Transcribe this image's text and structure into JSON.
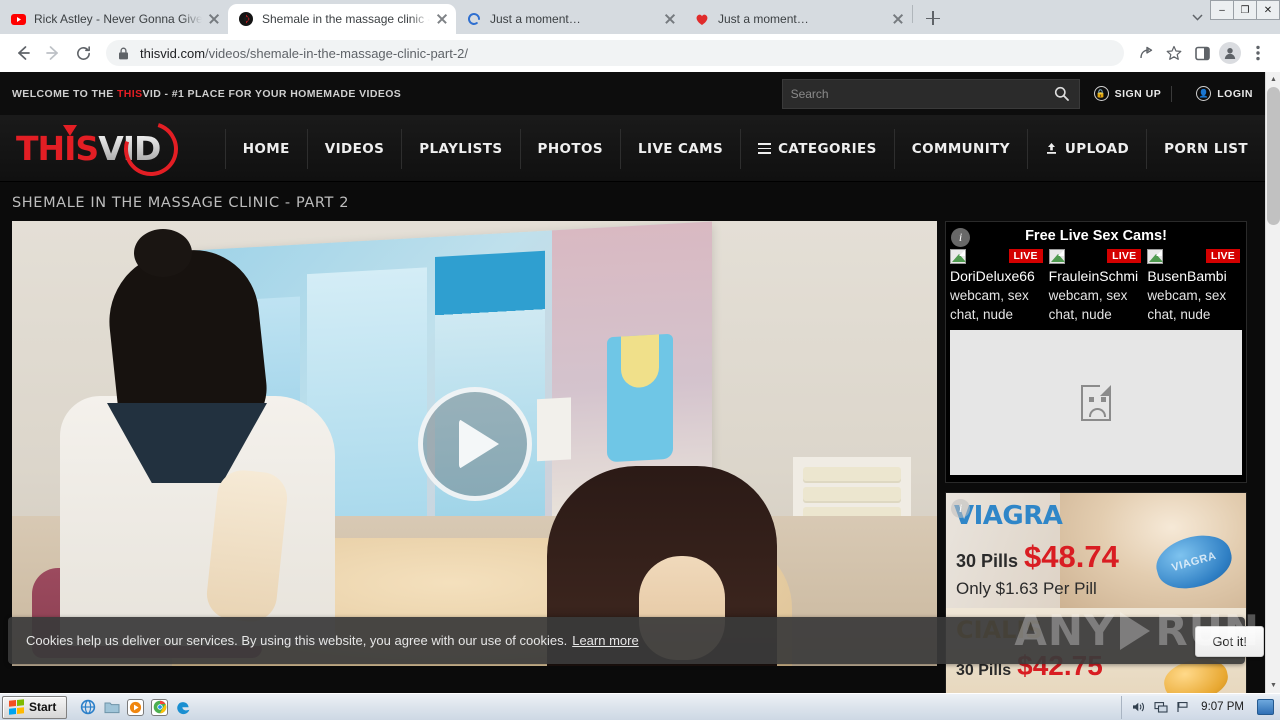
{
  "browser": {
    "tabs": [
      {
        "title": "Rick Astley - Never Gonna Give You",
        "favicon": "youtube-icon",
        "active": false
      },
      {
        "title": "Shemale in the massage clinic - part",
        "favicon": "thisvid-icon",
        "active": true
      },
      {
        "title": "Just a moment…",
        "favicon": "loading-spinner-icon",
        "active": false
      },
      {
        "title": "Just a moment…",
        "favicon": "heart-icon",
        "active": false
      }
    ],
    "new_tab_label": "+",
    "url_host": "thisvid.com",
    "url_path": "/videos/shemale-in-the-massage-clinic-part-2/",
    "window_controls": {
      "minimize": "–",
      "maximize": "❐",
      "close": "✕"
    }
  },
  "site": {
    "welcome_prefix": "WELCOME TO THE ",
    "welcome_brand": "THIS",
    "welcome_suffix": "VID - #1 PLACE FOR YOUR HOMEMADE VIDEOS",
    "search": {
      "placeholder": "Search",
      "value": ""
    },
    "sign_up": "SIGN UP",
    "login": "LOGIN",
    "logo": {
      "part1": "THIS",
      "part2": "VID"
    },
    "nav": [
      {
        "label": "HOME"
      },
      {
        "label": "VIDEOS"
      },
      {
        "label": "PLAYLISTS"
      },
      {
        "label": "PHOTOS"
      },
      {
        "label": "LIVE CAMS"
      },
      {
        "label": "CATEGORIES"
      },
      {
        "label": "COMMUNITY"
      },
      {
        "label": "UPLOAD"
      },
      {
        "label": "PORN LIST"
      }
    ],
    "video_title": "SHEMALE IN THE MASSAGE CLINIC - PART 2"
  },
  "cookie_banner": {
    "text": "Cookies help us deliver our services. By using this website, you agree with our use of cookies.",
    "link": "Learn more",
    "button": "Got it!"
  },
  "ads": {
    "cams": {
      "title": "Free Live Sex Cams!",
      "live_badge": "LIVE",
      "items": [
        {
          "name": "DoriDeluxe66",
          "desc_line1": "webcam, sex",
          "desc_line2": "chat, nude"
        },
        {
          "name": "FrauleinSchmi",
          "desc_line1": "webcam, sex",
          "desc_line2": "chat, nude"
        },
        {
          "name": "BusenBambi",
          "desc_line1": "webcam, sex",
          "desc_line2": "chat, nude"
        }
      ]
    },
    "pharma": {
      "viagra_brand": "VIAGRA",
      "viagra_qty": "30 Pills",
      "viagra_price": "$48.74",
      "viagra_sub": "Only $1.63 Per Pill",
      "viagra_pill_label": "VIAGRA",
      "cialis_brand": "CIALIS",
      "cialis_qty": "30 Pills",
      "cialis_price": "$42.75"
    }
  },
  "watermark": {
    "left": "ANY",
    "right": "RUN"
  },
  "taskbar": {
    "start": "Start",
    "quick_launch": [
      "internet-explorer-icon",
      "folder-icon",
      "media-player-icon",
      "chrome-icon",
      "edge-icon"
    ],
    "tray": [
      "volume-icon",
      "network-icon",
      "flag-icon"
    ],
    "clock": "9:07 PM"
  },
  "colors": {
    "brand_red": "#e31e24",
    "live_red": "#d40000",
    "viagra_blue": "#2f86c8",
    "price_red": "#d91d22"
  }
}
